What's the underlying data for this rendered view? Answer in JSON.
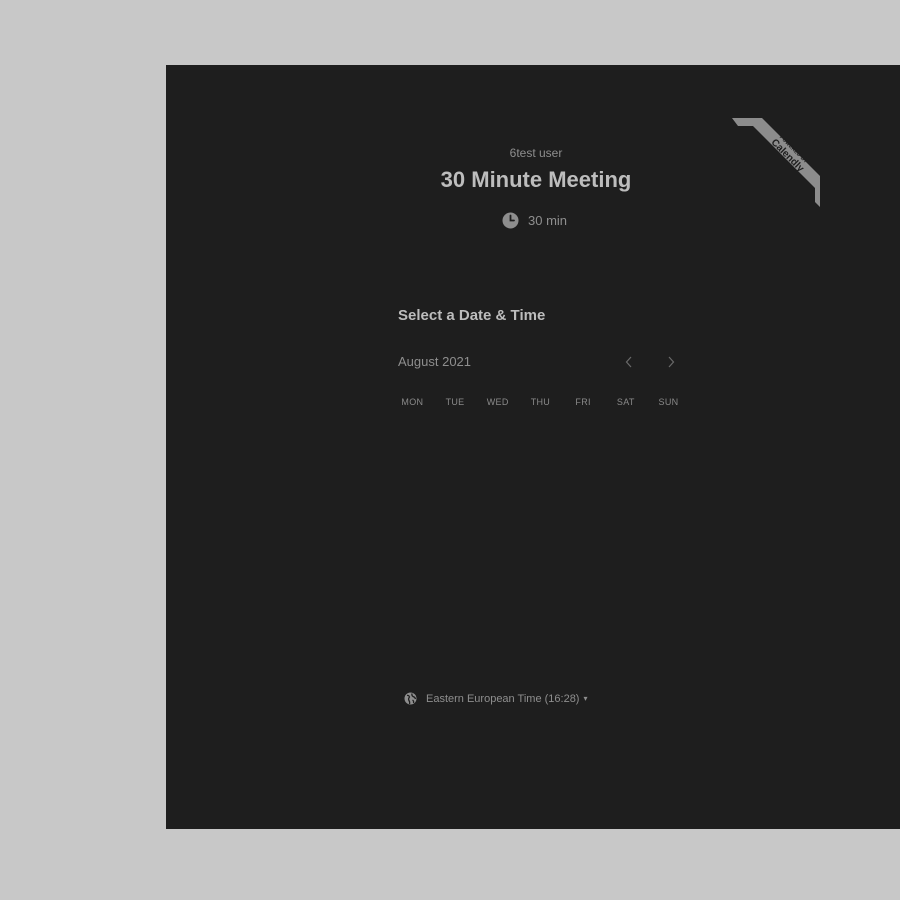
{
  "badge": {
    "powered_by": "POWERED BY",
    "brand": "Calendly"
  },
  "event": {
    "host_name": "6test user",
    "title": "30 Minute Meeting",
    "duration": "30 min"
  },
  "scheduler": {
    "heading": "Select a Date & Time",
    "month_label": "August 2021",
    "weekdays": [
      "MON",
      "TUE",
      "WED",
      "THU",
      "FRI",
      "SAT",
      "SUN"
    ]
  },
  "timezone": {
    "label": "Eastern European Time (16:28)",
    "caret": "▾"
  },
  "icons": {
    "clock": "clock-icon",
    "globe": "globe-icon",
    "prev": "chevron-left-icon",
    "next": "chevron-right-icon"
  },
  "colors": {
    "page_background": "#c8c8c8",
    "panel_background": "#1e1e1e",
    "ribbon": "#8c8c8c",
    "text_primary": "#bdbdbd",
    "text_secondary": "#8e8e8e"
  }
}
